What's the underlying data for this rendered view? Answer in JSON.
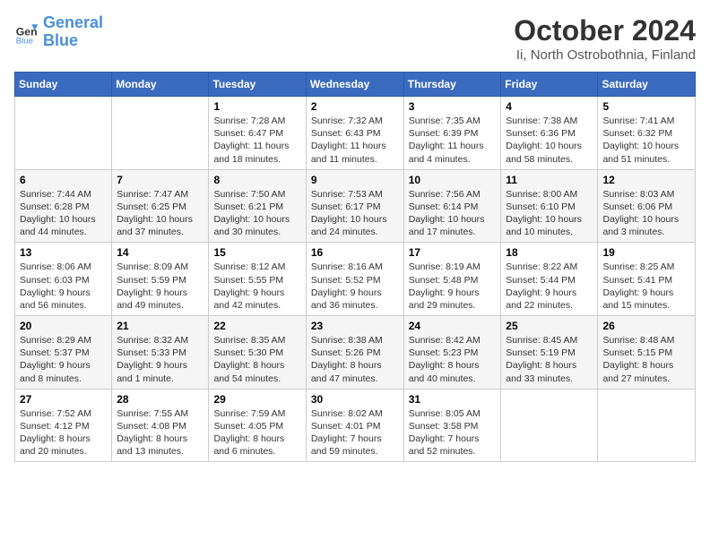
{
  "logo": {
    "line1": "General",
    "line2": "Blue"
  },
  "title": "October 2024",
  "subtitle": "Ii, North Ostrobothnia, Finland",
  "header": {
    "days": [
      "Sunday",
      "Monday",
      "Tuesday",
      "Wednesday",
      "Thursday",
      "Friday",
      "Saturday"
    ]
  },
  "weeks": [
    [
      {
        "num": "",
        "info": ""
      },
      {
        "num": "",
        "info": ""
      },
      {
        "num": "1",
        "info": "Sunrise: 7:28 AM\nSunset: 6:47 PM\nDaylight: 11 hours\nand 18 minutes."
      },
      {
        "num": "2",
        "info": "Sunrise: 7:32 AM\nSunset: 6:43 PM\nDaylight: 11 hours\nand 11 minutes."
      },
      {
        "num": "3",
        "info": "Sunrise: 7:35 AM\nSunset: 6:39 PM\nDaylight: 11 hours\nand 4 minutes."
      },
      {
        "num": "4",
        "info": "Sunrise: 7:38 AM\nSunset: 6:36 PM\nDaylight: 10 hours\nand 58 minutes."
      },
      {
        "num": "5",
        "info": "Sunrise: 7:41 AM\nSunset: 6:32 PM\nDaylight: 10 hours\nand 51 minutes."
      }
    ],
    [
      {
        "num": "6",
        "info": "Sunrise: 7:44 AM\nSunset: 6:28 PM\nDaylight: 10 hours\nand 44 minutes."
      },
      {
        "num": "7",
        "info": "Sunrise: 7:47 AM\nSunset: 6:25 PM\nDaylight: 10 hours\nand 37 minutes."
      },
      {
        "num": "8",
        "info": "Sunrise: 7:50 AM\nSunset: 6:21 PM\nDaylight: 10 hours\nand 30 minutes."
      },
      {
        "num": "9",
        "info": "Sunrise: 7:53 AM\nSunset: 6:17 PM\nDaylight: 10 hours\nand 24 minutes."
      },
      {
        "num": "10",
        "info": "Sunrise: 7:56 AM\nSunset: 6:14 PM\nDaylight: 10 hours\nand 17 minutes."
      },
      {
        "num": "11",
        "info": "Sunrise: 8:00 AM\nSunset: 6:10 PM\nDaylight: 10 hours\nand 10 minutes."
      },
      {
        "num": "12",
        "info": "Sunrise: 8:03 AM\nSunset: 6:06 PM\nDaylight: 10 hours\nand 3 minutes."
      }
    ],
    [
      {
        "num": "13",
        "info": "Sunrise: 8:06 AM\nSunset: 6:03 PM\nDaylight: 9 hours\nand 56 minutes."
      },
      {
        "num": "14",
        "info": "Sunrise: 8:09 AM\nSunset: 5:59 PM\nDaylight: 9 hours\nand 49 minutes."
      },
      {
        "num": "15",
        "info": "Sunrise: 8:12 AM\nSunset: 5:55 PM\nDaylight: 9 hours\nand 42 minutes."
      },
      {
        "num": "16",
        "info": "Sunrise: 8:16 AM\nSunset: 5:52 PM\nDaylight: 9 hours\nand 36 minutes."
      },
      {
        "num": "17",
        "info": "Sunrise: 8:19 AM\nSunset: 5:48 PM\nDaylight: 9 hours\nand 29 minutes."
      },
      {
        "num": "18",
        "info": "Sunrise: 8:22 AM\nSunset: 5:44 PM\nDaylight: 9 hours\nand 22 minutes."
      },
      {
        "num": "19",
        "info": "Sunrise: 8:25 AM\nSunset: 5:41 PM\nDaylight: 9 hours\nand 15 minutes."
      }
    ],
    [
      {
        "num": "20",
        "info": "Sunrise: 8:29 AM\nSunset: 5:37 PM\nDaylight: 9 hours\nand 8 minutes."
      },
      {
        "num": "21",
        "info": "Sunrise: 8:32 AM\nSunset: 5:33 PM\nDaylight: 9 hours\nand 1 minute."
      },
      {
        "num": "22",
        "info": "Sunrise: 8:35 AM\nSunset: 5:30 PM\nDaylight: 8 hours\nand 54 minutes."
      },
      {
        "num": "23",
        "info": "Sunrise: 8:38 AM\nSunset: 5:26 PM\nDaylight: 8 hours\nand 47 minutes."
      },
      {
        "num": "24",
        "info": "Sunrise: 8:42 AM\nSunset: 5:23 PM\nDaylight: 8 hours\nand 40 minutes."
      },
      {
        "num": "25",
        "info": "Sunrise: 8:45 AM\nSunset: 5:19 PM\nDaylight: 8 hours\nand 33 minutes."
      },
      {
        "num": "26",
        "info": "Sunrise: 8:48 AM\nSunset: 5:15 PM\nDaylight: 8 hours\nand 27 minutes."
      }
    ],
    [
      {
        "num": "27",
        "info": "Sunrise: 7:52 AM\nSunset: 4:12 PM\nDaylight: 8 hours\nand 20 minutes."
      },
      {
        "num": "28",
        "info": "Sunrise: 7:55 AM\nSunset: 4:08 PM\nDaylight: 8 hours\nand 13 minutes."
      },
      {
        "num": "29",
        "info": "Sunrise: 7:59 AM\nSunset: 4:05 PM\nDaylight: 8 hours\nand 6 minutes."
      },
      {
        "num": "30",
        "info": "Sunrise: 8:02 AM\nSunset: 4:01 PM\nDaylight: 7 hours\nand 59 minutes."
      },
      {
        "num": "31",
        "info": "Sunrise: 8:05 AM\nSunset: 3:58 PM\nDaylight: 7 hours\nand 52 minutes."
      },
      {
        "num": "",
        "info": ""
      },
      {
        "num": "",
        "info": ""
      }
    ]
  ]
}
